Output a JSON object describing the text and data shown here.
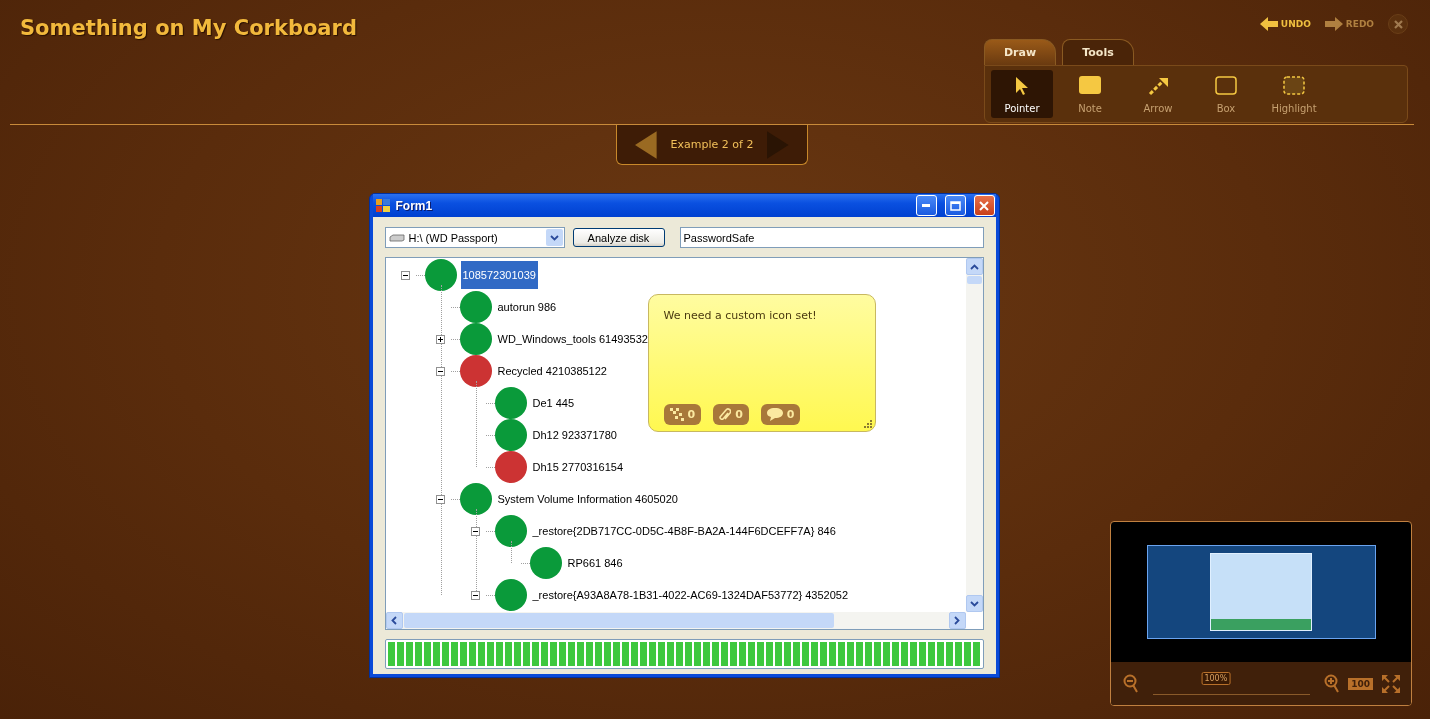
{
  "app": {
    "title": "Something on My Corkboard",
    "undo": {
      "label": "UNDO",
      "disabled": false
    },
    "redo": {
      "label": "REDO",
      "disabled": true
    }
  },
  "draw_tabs": [
    {
      "label": "Draw",
      "selected": true
    },
    {
      "label": "Tools",
      "selected": false
    }
  ],
  "tools": [
    {
      "kind": "pointer",
      "label": "Pointer",
      "selected": true
    },
    {
      "kind": "note",
      "label": "Note",
      "selected": false
    },
    {
      "kind": "arrow",
      "label": "Arrow",
      "selected": false
    },
    {
      "kind": "box",
      "label": "Box",
      "selected": false
    },
    {
      "kind": "highlight",
      "label": "Highlight",
      "selected": false
    }
  ],
  "example_nav": {
    "label": "Example 2 of 2",
    "prev_disabled": false,
    "next_disabled": true
  },
  "form": {
    "title": "Form1",
    "drive": "H:\\ (WD Passport)",
    "analyze_button": "Analyze disk",
    "search_value": "PasswordSafe",
    "tree": [
      {
        "label": "108572301039",
        "color": "#0a9a3a",
        "expanded": true,
        "selected": true,
        "children": [
          {
            "label": "autorun 986",
            "color": "#0a9a3a",
            "selected": false
          },
          {
            "label": "WD_Windows_tools 61493532",
            "color": "#0a9a3a",
            "expanded": false,
            "selected": false
          },
          {
            "label": "Recycled 4210385122",
            "color": "#cc3333",
            "expanded": true,
            "selected": false,
            "children": [
              {
                "label": "De1 445",
                "color": "#0a9a3a",
                "selected": false
              },
              {
                "label": "Dh12 923371780",
                "color": "#0a9a3a",
                "selected": false
              },
              {
                "label": "Dh15 2770316154",
                "color": "#cc3333",
                "selected": false
              }
            ]
          },
          {
            "label": "System Volume Information 4605020",
            "color": "#0a9a3a",
            "expanded": true,
            "selected": false,
            "children": [
              {
                "label": "_restore{2DB717CC-0D5C-4B8F-BA2A-144F6DCEFF7A} 846",
                "color": "#0a9a3a",
                "expanded": true,
                "selected": false,
                "children": [
                  {
                    "label": "RP661 846",
                    "color": "#0a9a3a",
                    "selected": false
                  }
                ]
              },
              {
                "label": "_restore{A93A8A78-1B31-4022-AC69-1324DAF53772} 4352052",
                "color": "#0a9a3a",
                "expanded": true,
                "selected": false
              }
            ]
          }
        ]
      }
    ],
    "progress": {
      "level": 1.0
    }
  },
  "sticky_note": {
    "text": "We need a custom icon set!",
    "counters": [
      {
        "kind": "tags",
        "count": "0"
      },
      {
        "kind": "attachments",
        "count": "0"
      },
      {
        "kind": "comments",
        "count": "0"
      }
    ]
  },
  "minimap": {
    "zoom_slider": {
      "label": "100%",
      "level": 0.4
    },
    "actual_size_label": "100"
  }
}
